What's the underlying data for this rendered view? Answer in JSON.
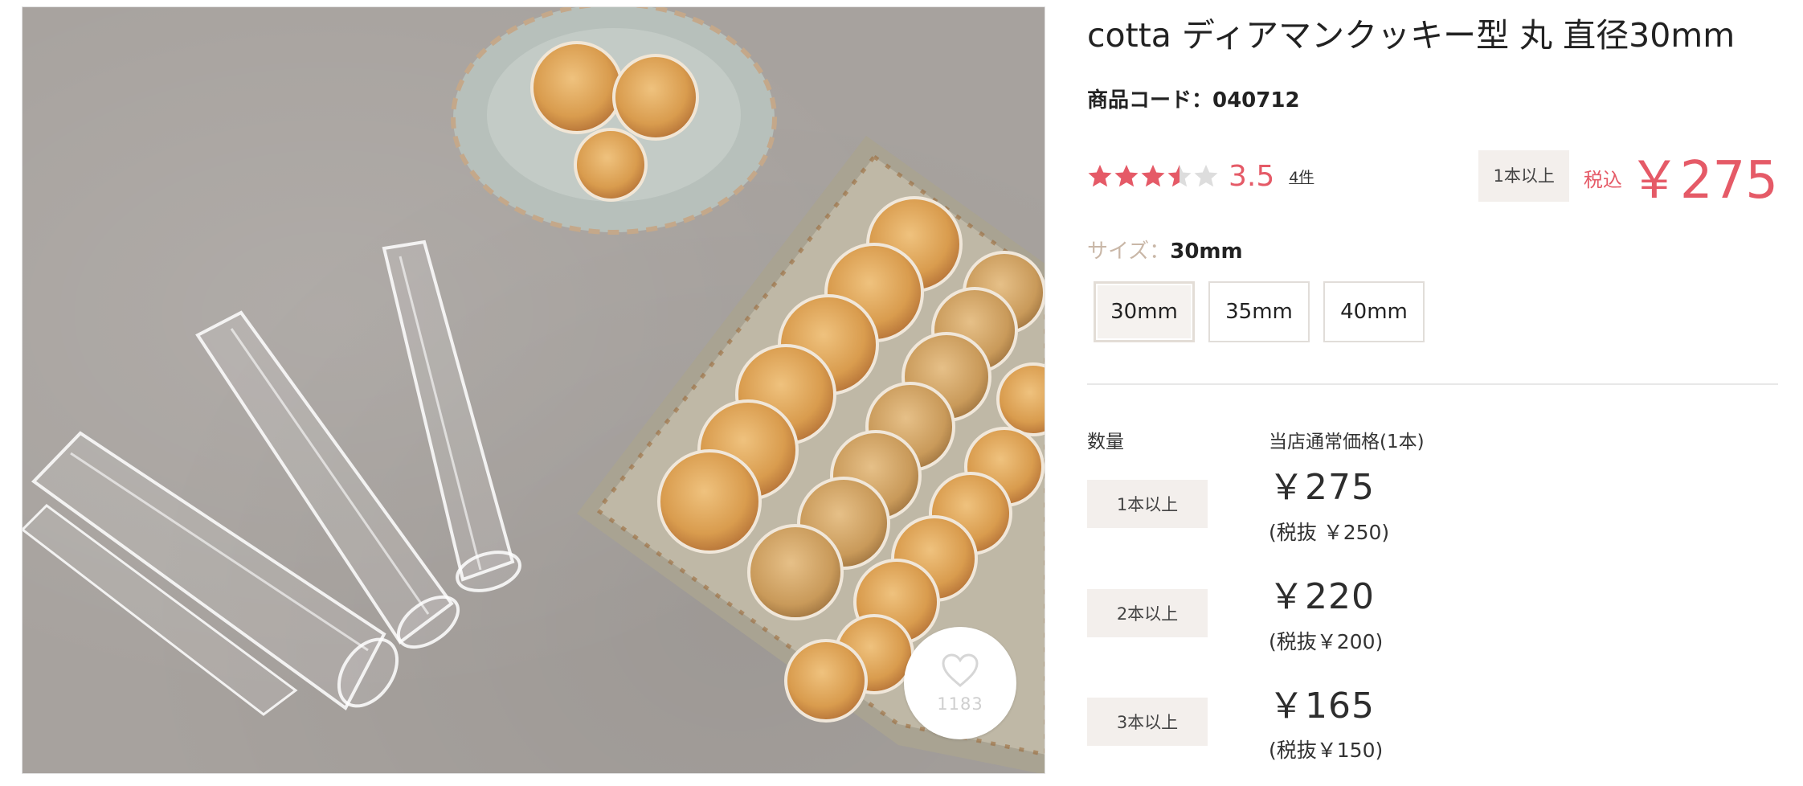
{
  "product": {
    "title": "cotta ディアマンクッキー型 丸 直径30mm",
    "code_label": "商品コード：040712"
  },
  "image": {
    "favorite_icon": "heart-icon",
    "favorite_count": "1183"
  },
  "rating": {
    "value": 3.5,
    "max": 5,
    "score_text": "3.5",
    "reviews_text": "4件",
    "star_color": "#e55a67",
    "empty_star_color": "#dddddd"
  },
  "price_summary": {
    "qty_label": "1本以上",
    "tax_label": "税込",
    "price": "￥275"
  },
  "size": {
    "label": "サイズ：",
    "value": "30mm",
    "options": [
      "30mm",
      "35mm",
      "40mm"
    ],
    "selected": "30mm"
  },
  "tiers": {
    "qty_header": "数量",
    "price_header": "当店通常価格(1本)",
    "rows": [
      {
        "qty": "1本以上",
        "price": "￥275",
        "tax_excluded": "(税抜 ￥250)"
      },
      {
        "qty": "2本以上",
        "price": "￥220",
        "tax_excluded": "(税抜￥200)"
      },
      {
        "qty": "3本以上",
        "price": "￥165",
        "tax_excluded": "(税抜￥150)"
      }
    ]
  },
  "colors": {
    "accent": "#e55a67",
    "tag_bg": "#f3efec",
    "size_label": "#c9b7a7"
  }
}
